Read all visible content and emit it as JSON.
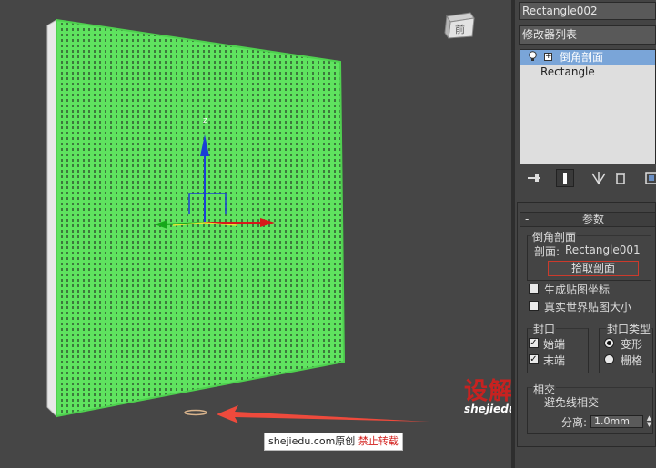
{
  "viewport": {
    "viewcube_label": "前",
    "gizmo_axis_z": "z",
    "gizmo_axis_x": "x",
    "mesh_color": "#5fe35f"
  },
  "panel": {
    "object_name": "Rectangle002",
    "modifier_list": "修改器列表",
    "stack": [
      {
        "label": "倒角剖面",
        "selected": true
      },
      {
        "label": "Rectangle",
        "selected": false
      }
    ],
    "rollout": {
      "collapse": "-",
      "title": "参数",
      "group_bevel_profile": "倒角剖面",
      "profile_label": "剖面:",
      "profile_value": "Rectangle001",
      "pick_profile_button": "拾取剖面",
      "gen_map_coords": "生成贴图坐标",
      "real_world_map_size": "真实世界贴图大小",
      "cap_group": "封口",
      "cap_start": "始端",
      "cap_end": "末端",
      "cap_type_group": "封口类型",
      "cap_morph": "变形",
      "cap_grid": "栅格",
      "intersect_group": "相交",
      "avoid_intersect": "避免线相交",
      "separation_label": "分离:",
      "separation_value": "1.0mm"
    }
  },
  "watermark": {
    "big": "设解读",
    "url": "shejiedu.com"
  },
  "footer": {
    "site": "shejiedu.com",
    "original": "原创",
    "no_repost": "禁止转载"
  },
  "colors": {
    "accent_red": "#d3201d",
    "selection_blue": "#7aa5d8",
    "axis_z": "#1a3fd6",
    "axis_x": "#d61a1a",
    "axis_y": "#17a81a"
  }
}
